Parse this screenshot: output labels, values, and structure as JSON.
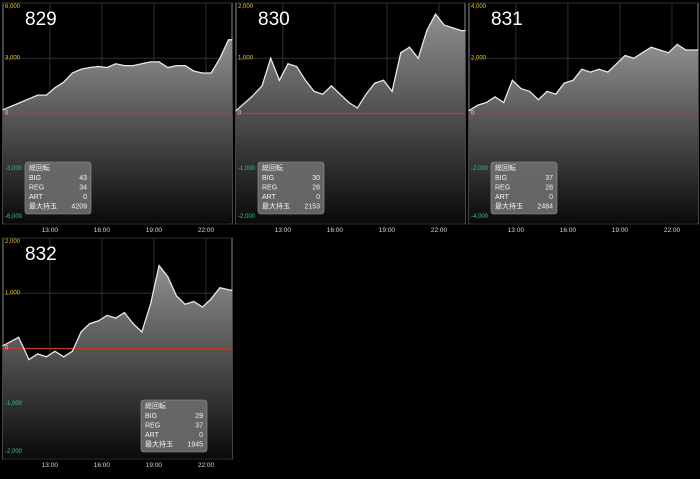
{
  "page": {
    "background": "#000000"
  },
  "style": {
    "grid_color": "#2f2f2f",
    "panel_border": "#8a8a8a",
    "zero_line_color": "#c0392b",
    "pos_tick_color": "#f0c419",
    "neg_tick_color": "#2ecc71",
    "x_tick_color": "#d8d8d8",
    "line_color": "#e8e8e8",
    "fill_top": "#8f8f8f",
    "fill_bottom": "#0a0a0a"
  },
  "chart_data": [
    {
      "type": "area",
      "title": "829",
      "xticks": [
        "13:00",
        "16:00",
        "19:00",
        "22:00"
      ],
      "yticks": [
        6000,
        3000,
        0,
        -3000,
        -6000
      ],
      "ytick_labels": [
        "6,000",
        "3,000",
        "0",
        "-3,000",
        "-6,000"
      ],
      "ylim": [
        -6000,
        6000
      ],
      "xlim": [
        10.3,
        23.5
      ],
      "x": [
        10.3,
        10.8,
        11.3,
        11.8,
        12.3,
        12.8,
        13.3,
        13.8,
        14.3,
        14.8,
        15.3,
        15.8,
        16.3,
        16.8,
        17.3,
        17.8,
        18.3,
        18.8,
        19.3,
        19.8,
        20.3,
        20.8,
        21.3,
        21.8,
        22.3,
        22.8,
        23.3,
        23.5
      ],
      "y": [
        200,
        400,
        600,
        800,
        1000,
        1000,
        1400,
        1700,
        2200,
        2400,
        2500,
        2550,
        2500,
        2700,
        2600,
        2600,
        2700,
        2800,
        2800,
        2500,
        2600,
        2600,
        2300,
        2200,
        2200,
        3000,
        4000,
        4000
      ],
      "stats": {
        "header": "総回転",
        "rows": [
          [
            "BIG",
            "43"
          ],
          [
            "REG",
            "34"
          ],
          [
            "ART",
            "0"
          ],
          [
            "最大持玉",
            "4209"
          ]
        ]
      }
    },
    {
      "type": "area",
      "title": "830",
      "xticks": [
        "13:00",
        "16:00",
        "19:00",
        "22:00"
      ],
      "yticks": [
        2000,
        1000,
        0,
        -1000,
        -2000
      ],
      "ytick_labels": [
        "2,000",
        "1,000",
        "0",
        "-1,000",
        "-2,000"
      ],
      "ylim": [
        -2000,
        2000
      ],
      "xlim": [
        10.3,
        23.5
      ],
      "x": [
        10.3,
        11.2,
        11.8,
        12.3,
        12.8,
        13.3,
        13.8,
        14.3,
        14.8,
        15.3,
        15.8,
        16.3,
        16.8,
        17.3,
        17.8,
        18.3,
        18.8,
        19.3,
        19.8,
        20.3,
        20.8,
        21.3,
        21.8,
        22.3,
        22.8,
        23.3,
        23.5
      ],
      "y": [
        50,
        300,
        500,
        1000,
        600,
        900,
        850,
        600,
        400,
        350,
        500,
        350,
        200,
        100,
        350,
        550,
        600,
        400,
        1100,
        1200,
        1000,
        1500,
        1800,
        1600,
        1550,
        1500,
        1500
      ],
      "stats": {
        "header": "総回転",
        "rows": [
          [
            "BIG",
            "30"
          ],
          [
            "REG",
            "28"
          ],
          [
            "ART",
            "0"
          ],
          [
            "最大持玉",
            "2153"
          ]
        ]
      }
    },
    {
      "type": "area",
      "title": "831",
      "xticks": [
        "13:00",
        "16:00",
        "19:00",
        "22:00"
      ],
      "yticks": [
        4000,
        2000,
        0,
        -2000,
        -4000
      ],
      "ytick_labels": [
        "4,000",
        "2,000",
        "0",
        "-2,000",
        "-4,000"
      ],
      "ylim": [
        -4000,
        4000
      ],
      "xlim": [
        10.3,
        23.5
      ],
      "x": [
        10.3,
        10.8,
        11.3,
        11.8,
        12.3,
        12.8,
        13.3,
        13.8,
        14.3,
        14.8,
        15.3,
        15.8,
        16.3,
        16.8,
        17.3,
        17.8,
        18.3,
        18.8,
        19.3,
        19.8,
        20.3,
        20.8,
        21.3,
        21.8,
        22.3,
        22.8,
        23.3,
        23.5
      ],
      "y": [
        100,
        300,
        400,
        600,
        400,
        1200,
        900,
        800,
        500,
        800,
        700,
        1100,
        1200,
        1600,
        1500,
        1600,
        1500,
        1800,
        2100,
        2000,
        2200,
        2400,
        2300,
        2200,
        2500,
        2300,
        2300,
        2300
      ],
      "stats": {
        "header": "総回転",
        "rows": [
          [
            "BIG",
            "37"
          ],
          [
            "REG",
            "28"
          ],
          [
            "ART",
            "0"
          ],
          [
            "最大持玉",
            "2484"
          ]
        ]
      }
    },
    {
      "type": "area",
      "title": "832",
      "xticks": [
        "13:00",
        "16:00",
        "19:00",
        "22:00"
      ],
      "yticks": [
        2000,
        1000,
        0,
        -1000,
        -2000
      ],
      "ytick_labels": [
        "2,000",
        "1,000",
        "0",
        "-1,000",
        "-2,000"
      ],
      "ylim": [
        -2000,
        2000
      ],
      "xlim": [
        10.3,
        23.5
      ],
      "x": [
        10.3,
        11.2,
        11.8,
        12.3,
        12.8,
        13.3,
        13.8,
        14.3,
        14.8,
        15.3,
        15.8,
        16.3,
        16.8,
        17.3,
        17.8,
        18.3,
        18.8,
        19.3,
        19.8,
        20.3,
        20.8,
        21.3,
        21.8,
        22.3,
        22.8,
        23.5
      ],
      "y": [
        50,
        200,
        -200,
        -100,
        -150,
        -50,
        -150,
        -50,
        300,
        450,
        500,
        600,
        550,
        650,
        450,
        300,
        800,
        1500,
        1300,
        950,
        800,
        850,
        750,
        900,
        1100,
        1050
      ],
      "stats": {
        "header": "総回転",
        "rows": [
          [
            "BIG",
            "29"
          ],
          [
            "REG",
            "37"
          ],
          [
            "ART",
            "0"
          ],
          [
            "最大持玉",
            "1945"
          ]
        ]
      }
    }
  ]
}
